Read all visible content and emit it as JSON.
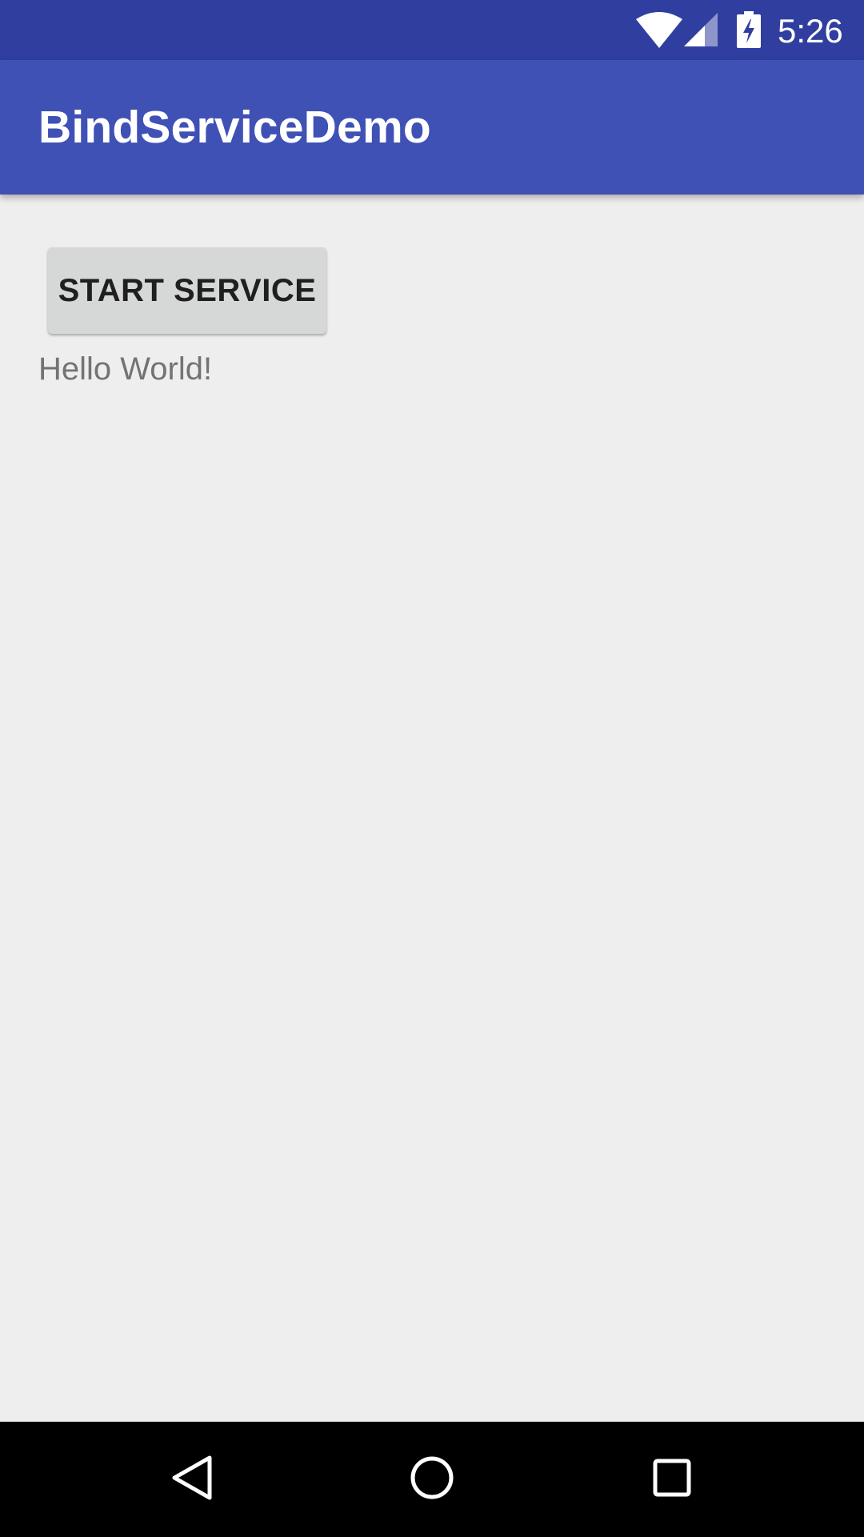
{
  "status_bar": {
    "time": "5:26",
    "icons": [
      "wifi-icon",
      "cellular-signal-icon",
      "battery-charging-icon"
    ],
    "background_color": "#303f9f"
  },
  "app_bar": {
    "title": "BindServiceDemo",
    "background_color": "#3f51b5"
  },
  "main": {
    "start_button_label": "START SERVICE",
    "hello_text": "Hello World!"
  },
  "nav_bar": {
    "icons": [
      "back-icon",
      "home-icon",
      "recents-icon"
    ]
  }
}
